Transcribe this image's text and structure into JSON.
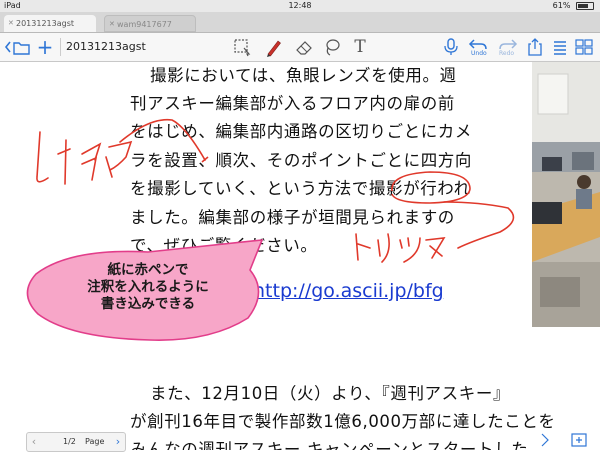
{
  "status_bar": {
    "carrier": "iPad",
    "time": "12:48",
    "battery": "61%"
  },
  "tabs": [
    {
      "label": "20131213agst",
      "active": true
    },
    {
      "label": "wam9417677",
      "active": false
    }
  ],
  "toolbar": {
    "document_title": "20131213agst",
    "undo_label": "Undo",
    "redo_label": "Redo"
  },
  "document": {
    "lines": [
      "撮影においては、魚眼レンズを使用。週",
      "刊アスキー編集部が入るフロア内の扉の前",
      "をはじめ、編集部内通路の区切りごとにカメ",
      "ラを設置、順次、そのポイントごとに四方向",
      "を撮影していく、という方法で撮影が行われ",
      "ました。編集部の様子が垣間見られますの",
      "で、ぜひご覧ください。"
    ],
    "url": "http://go.ascii.jp/bfg",
    "lines_bottom": [
      "また、12月10日（火）より、『週刊アスキー』",
      "が創刊16年目で製作部数1億6,000万部に達したことを",
      "みんなの週刊アスキー キャンペーンとスタートした"
    ]
  },
  "annotations": {
    "left_handwriting": "レイアウト",
    "bottom_handwriting": "トルツメ"
  },
  "callout": {
    "lines": [
      "紙に赤ペンで",
      "注釈を入れるように",
      "書き込みできる"
    ]
  },
  "pager": {
    "page": "1/2",
    "label": "Page"
  },
  "colors": {
    "accent": "#2f76d6",
    "ink": "#e0392b",
    "callout_fill": "#f7a6c8",
    "callout_stroke": "#e23d8a",
    "link": "#1a3bd0"
  }
}
